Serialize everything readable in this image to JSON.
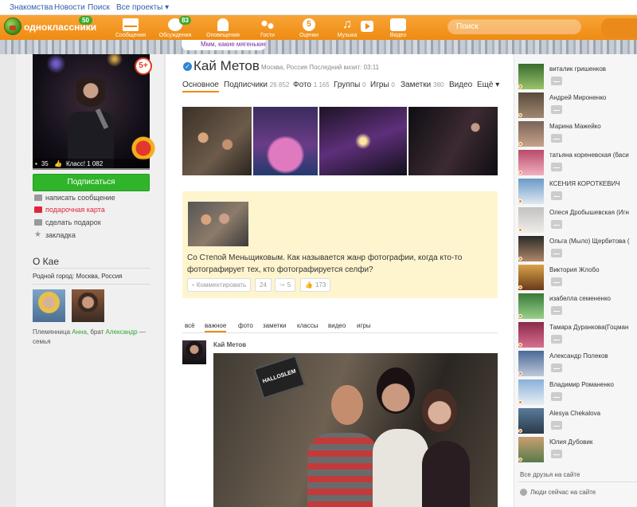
{
  "topbar": {
    "links": [
      "Знакомства",
      "Новости",
      "Поиск",
      "Все проекты ▾"
    ]
  },
  "header": {
    "logo": "одноклассники",
    "logo_badge": "50",
    "nav": [
      {
        "label": "Сообщения",
        "icon": "envelope-icon",
        "badge": ""
      },
      {
        "label": "Обсуждения",
        "icon": "chat-icon",
        "badge": "83"
      },
      {
        "label": "Оповещения",
        "icon": "bell-icon",
        "badge": ""
      },
      {
        "label": "Гости",
        "icon": "footprints-icon",
        "badge": ""
      },
      {
        "label": "Оценки",
        "icon": "rating-icon",
        "badge": ""
      },
      {
        "label": "Музыка",
        "icon": "music-icon",
        "badge": ""
      },
      {
        "label": "Видео",
        "icon": "video-icon",
        "badge": ""
      }
    ],
    "search_placeholder": "Поиск",
    "accent": "#ef8b12"
  },
  "mood": "Ммм, какие мягенькие...",
  "profile": {
    "age_badge": "5+",
    "photo_comments": "35",
    "photo_likes": "Класс! 1 082",
    "subscribe": "Подписаться",
    "actions": [
      "написать сообщение",
      "подарочная карта",
      "сделать подарок",
      "закладка"
    ],
    "name": "Кай Метов",
    "location": "Москва, Россия",
    "last_visit": "Последний визит: 03:11",
    "tabs": [
      {
        "label": "Основное",
        "count": ""
      },
      {
        "label": "Подписчики",
        "count": "26 852"
      },
      {
        "label": "Фото",
        "count": "1 165"
      },
      {
        "label": "Группы",
        "count": "0"
      },
      {
        "label": "Игры",
        "count": "0"
      },
      {
        "label": "Заметки",
        "count": "380"
      },
      {
        "label": "Видео",
        "count": ""
      },
      {
        "label": "Ещё ▾",
        "count": ""
      }
    ]
  },
  "about": {
    "title": "О Кае",
    "hometown": "Родной город: Москва, Россия",
    "relatives_prefix": "Племянница ",
    "niece": "Анна",
    "relatives_mid": ", брат ",
    "brother": "Александр",
    "relatives_suffix": " — семья"
  },
  "post": {
    "text": "Со Степой Меньщиковым. Как называется жанр фотографии, когда кто-то фотографирует тех, кто фотографируется селфи?",
    "comment_label": "Комментировать",
    "comments": "24",
    "shares": "5",
    "likes": "173"
  },
  "feed": {
    "tabs": [
      "всё",
      "важное",
      "фото",
      "заметки",
      "классы",
      "видео",
      "игры"
    ],
    "author": "Кай Метов",
    "phone_text": "HALLOSLEM"
  },
  "friends": [
    "виталик гришенков",
    "Андрей Мироненко",
    "Марина Мажейко",
    "татьяна кореневская (баси",
    "КСЕНИЯ КОРОТКЕВИЧ",
    "Олеся Дробышевская (Игн",
    "Ольга (Мыло) Щербитова (",
    "Виктория Жлобо",
    "изабелла семененко",
    "Тамара Дуранкова(Гоцман",
    "Александр Полеков",
    "Владимир Романенко",
    "Alesya Chekalova",
    "Юлия Дубовик"
  ],
  "friends_footer": {
    "all_online": "Все друзья на сайте",
    "people_online": "Люди сейчас на сайте"
  }
}
